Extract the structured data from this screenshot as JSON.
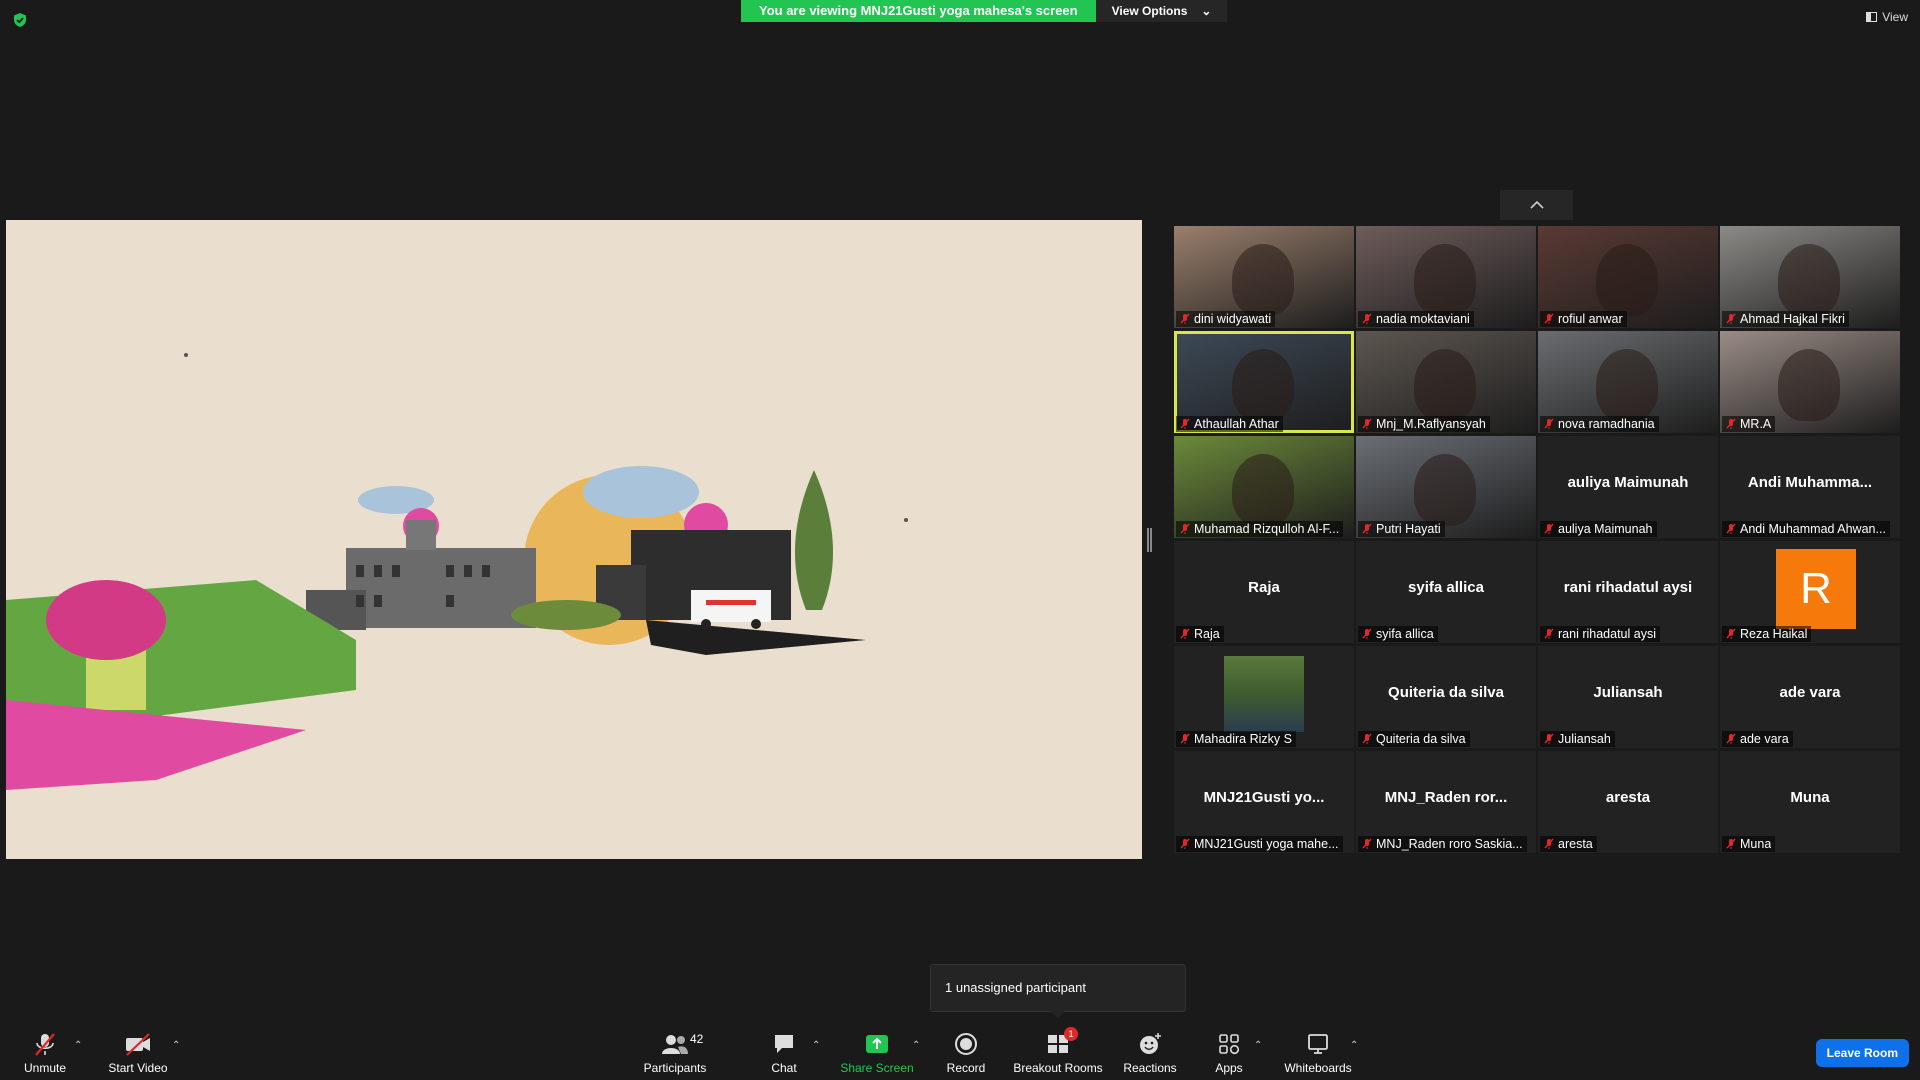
{
  "security_icon": "green-shield-icon",
  "banner": {
    "text": "You are viewing MNJ21Gusti yoga mahesa's screen",
    "view_options": "View Options",
    "bg": "#23c552"
  },
  "top_view_button": "View",
  "participants": [
    {
      "name": "dini widyawati",
      "label": "dini widyawati",
      "video": true,
      "muted": true
    },
    {
      "name": "nadia moktaviani",
      "label": "nadia moktaviani",
      "video": true,
      "muted": true
    },
    {
      "name": "rofiul anwar",
      "label": "rofiul anwar",
      "video": true,
      "muted": true
    },
    {
      "name": "Ahmad Hajkal Fikri",
      "label": "Ahmad Hajkal Fikri",
      "video": true,
      "muted": true
    },
    {
      "name": "Athaullah Athar",
      "label": "Athaullah Athar",
      "video": true,
      "muted": true,
      "active_speaker": true
    },
    {
      "name": "Mnj_M.Raflyansyah",
      "label": "Mnj_M.Raflyansyah",
      "video": true,
      "muted": true
    },
    {
      "name": "nova ramadhania",
      "label": "nova ramadhania",
      "video": true,
      "muted": true
    },
    {
      "name": "MR.A",
      "label": "MR.A",
      "video": true,
      "muted": true
    },
    {
      "name": "Muhamad Rizqulloh Al-F...",
      "label": "Muhamad Rizqulloh Al-F...",
      "video": true,
      "muted": true
    },
    {
      "name": "Putri Hayati",
      "label": "Putri Hayati",
      "video": true,
      "muted": true
    },
    {
      "name": "auliya Maimunah",
      "label": "auliya Maimunah",
      "video": false,
      "muted": true
    },
    {
      "name": "Andi  Muhamma...",
      "label": "Andi Muhammad Ahwan...",
      "video": false,
      "muted": true
    },
    {
      "name": "Raja",
      "label": "Raja",
      "video": false,
      "muted": true
    },
    {
      "name": "syifa allica",
      "label": "syifa allica",
      "video": false,
      "muted": true
    },
    {
      "name": "rani rihadatul aysi",
      "label": "rani rihadatul aysi",
      "video": false,
      "muted": true
    },
    {
      "name": "R",
      "label": "Reza Haikal",
      "video": false,
      "avatar": true,
      "avatar_color": "#f57a0b",
      "muted": true
    },
    {
      "name": "Mahadira Rizky S",
      "label": "Mahadira Rizky S",
      "video": false,
      "photo": true,
      "muted": true
    },
    {
      "name": "Quiteria da silva",
      "label": "Quiteria da silva",
      "video": false,
      "muted": true
    },
    {
      "name": "Juliansah",
      "label": "Juliansah",
      "video": false,
      "muted": true
    },
    {
      "name": "ade vara",
      "label": "ade vara",
      "video": false,
      "muted": true
    },
    {
      "name": "MNJ21Gusti yo...",
      "label": "MNJ21Gusti yoga mahe...",
      "video": false,
      "muted": true
    },
    {
      "name": "MNJ_Raden  ror...",
      "label": "MNJ_Raden roro Saskia...",
      "video": false,
      "muted": true
    },
    {
      "name": "aresta",
      "label": "aresta",
      "video": false,
      "muted": true
    },
    {
      "name": "Muna",
      "label": "Muna",
      "video": false,
      "muted": true
    }
  ],
  "tooltip": "1 unassigned participant",
  "toolbar": {
    "unmute": "Unmute",
    "start_video": "Start Video",
    "participants": "Participants",
    "participants_count": "42",
    "chat": "Chat",
    "share_screen": "Share Screen",
    "record": "Record",
    "breakout_rooms": "Breakout Rooms",
    "breakout_badge": "1",
    "reactions": "Reactions",
    "apps": "Apps",
    "whiteboards": "Whiteboards",
    "leave": "Leave Room",
    "leave_color": "#0e71eb"
  }
}
